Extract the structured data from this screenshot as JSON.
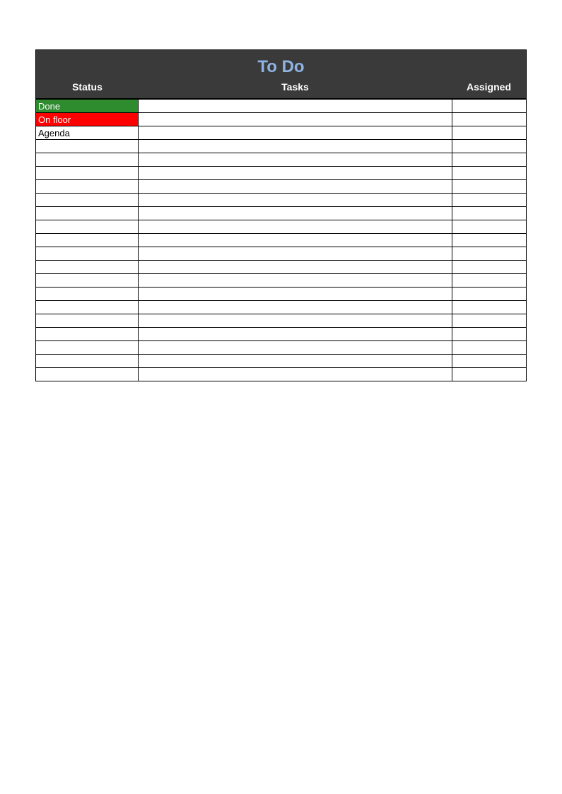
{
  "title": "To Do",
  "columns": {
    "status": "Status",
    "tasks": "Tasks",
    "assigned": "Assigned"
  },
  "rows": [
    {
      "status": "Done",
      "status_bg": "green",
      "tasks": "",
      "assigned": ""
    },
    {
      "status": "On floor",
      "status_bg": "red",
      "tasks": "",
      "assigned": ""
    },
    {
      "status": "Agenda",
      "status_bg": "white",
      "tasks": "",
      "assigned": ""
    },
    {
      "status": "",
      "status_bg": "white",
      "tasks": "",
      "assigned": ""
    },
    {
      "status": "",
      "status_bg": "white",
      "tasks": "",
      "assigned": ""
    },
    {
      "status": "",
      "status_bg": "white",
      "tasks": "",
      "assigned": ""
    },
    {
      "status": "",
      "status_bg": "white",
      "tasks": "",
      "assigned": ""
    },
    {
      "status": "",
      "status_bg": "white",
      "tasks": "",
      "assigned": ""
    },
    {
      "status": "",
      "status_bg": "white",
      "tasks": "",
      "assigned": ""
    },
    {
      "status": "",
      "status_bg": "white",
      "tasks": "",
      "assigned": ""
    },
    {
      "status": "",
      "status_bg": "white",
      "tasks": "",
      "assigned": ""
    },
    {
      "status": "",
      "status_bg": "white",
      "tasks": "",
      "assigned": ""
    },
    {
      "status": "",
      "status_bg": "white",
      "tasks": "",
      "assigned": ""
    },
    {
      "status": "",
      "status_bg": "white",
      "tasks": "",
      "assigned": ""
    },
    {
      "status": "",
      "status_bg": "white",
      "tasks": "",
      "assigned": ""
    },
    {
      "status": "",
      "status_bg": "white",
      "tasks": "",
      "assigned": ""
    },
    {
      "status": "",
      "status_bg": "white",
      "tasks": "",
      "assigned": ""
    },
    {
      "status": "",
      "status_bg": "white",
      "tasks": "",
      "assigned": ""
    },
    {
      "status": "",
      "status_bg": "white",
      "tasks": "",
      "assigned": ""
    },
    {
      "status": "",
      "status_bg": "white",
      "tasks": "",
      "assigned": ""
    },
    {
      "status": "",
      "status_bg": "white",
      "tasks": "",
      "assigned": ""
    }
  ]
}
